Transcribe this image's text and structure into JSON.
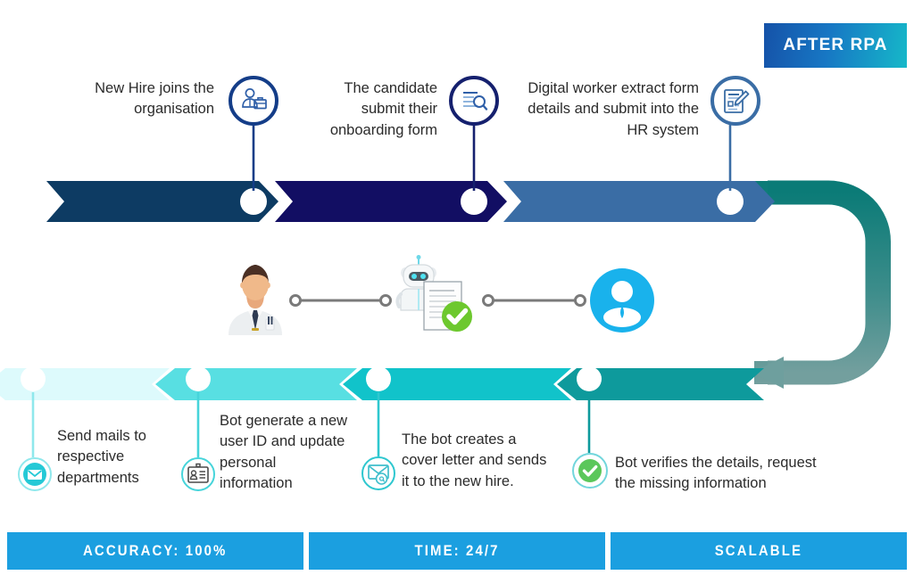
{
  "badge": {
    "label": "AFTER RPA"
  },
  "colors": {
    "seg1": "#0d3b63",
    "seg2": "#120e63",
    "seg3": "#3a6da5",
    "curve_top": "#0b7b77",
    "curve_bottom": "#6e9f9e",
    "bseg1": "#ddfafc",
    "bseg2": "#58dfe2",
    "bseg3": "#11c3ca",
    "bseg4": "#0e9a9c",
    "accent_blue": "#1b9fe0",
    "green": "#5bc75b",
    "cyan": "#25c9d6",
    "navy_ring": "#15206e",
    "dark_blue_ring": "#143d88",
    "steel_ring": "#3a6da5"
  },
  "top_steps": [
    {
      "caption": "New Hire joins the\norganisation",
      "icon": "employee-briefcase-icon"
    },
    {
      "caption": "The candidate\nsubmit their\nonboarding form",
      "icon": "document-search-icon"
    },
    {
      "caption": "Digital worker extract form\ndetails and submit into the\nHR system",
      "icon": "form-edit-icon"
    }
  ],
  "middle": {
    "person": "businessman-avatar",
    "robot": "robot-document-verified-icon",
    "user": "user-profile-icon",
    "connector_left": "connector-line",
    "connector_right": "connector-line"
  },
  "bottom_steps": [
    {
      "caption": "Send mails to\nrespective\ndepartments",
      "icon": "envelope-icon"
    },
    {
      "caption": "Bot generate a new\nuser ID and update\npersonal\ninformation",
      "icon": "id-badge-icon"
    },
    {
      "caption": "The bot creates a\ncover letter and sends\nit to the new hire.",
      "icon": "envelope-at-icon"
    },
    {
      "caption": "Bot verifies the details, request\nthe missing information",
      "icon": "check-circle-icon"
    }
  ],
  "stats": [
    {
      "label": "ACCURACY: 100%"
    },
    {
      "label": "TIME: 24/7"
    },
    {
      "label": "SCALABLE"
    }
  ]
}
